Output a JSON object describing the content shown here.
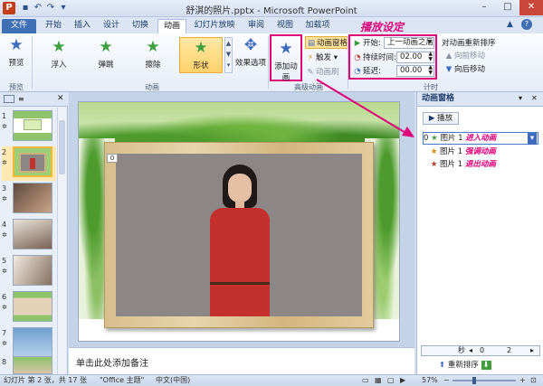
{
  "titlebar": {
    "title": "舒淇的照片.pptx - Microsoft PowerPoint",
    "app_icon": "P",
    "minimize": "–",
    "maximize": "□",
    "close": "✕",
    "help": "?",
    "ribbon_min": "▲"
  },
  "tabs": [
    {
      "label": "文件"
    },
    {
      "label": "开始"
    },
    {
      "label": "插入"
    },
    {
      "label": "设计"
    },
    {
      "label": "切换"
    },
    {
      "label": "动画"
    },
    {
      "label": "幻灯片放映"
    },
    {
      "label": "审阅"
    },
    {
      "label": "视图"
    },
    {
      "label": "加载项"
    }
  ],
  "ribbon": {
    "preview": {
      "label": "预览",
      "group": "预览"
    },
    "animations": [
      {
        "label": "浮入"
      },
      {
        "label": "弹跳"
      },
      {
        "label": "擦除"
      },
      {
        "label": "形状"
      }
    ],
    "animation_group": "动画",
    "effect_options": "效果选项",
    "add_animation": "添加动画",
    "anim_pane_btn": "动画窗格",
    "trigger": "触发",
    "anim_painter": "动画刷",
    "advanced_group": "高级动画",
    "start_label": "开始:",
    "start_value": "上一动画之后",
    "duration_label": "持续时间:",
    "duration_value": "02.00",
    "delay_label": "延迟:",
    "delay_value": "00.00",
    "reorder_title": "对动画重新排序",
    "move_earlier": "向前移动",
    "move_later": "向后移动",
    "timing_group": "计时",
    "annotation": "播放设定"
  },
  "slides": [
    {
      "num": "1"
    },
    {
      "num": "2"
    },
    {
      "num": "3"
    },
    {
      "num": "4"
    },
    {
      "num": "5"
    },
    {
      "num": "6"
    },
    {
      "num": "7"
    },
    {
      "num": "8"
    }
  ],
  "slide_badge": "0",
  "notes_placeholder": "单击此处添加备注",
  "anim_pane": {
    "title": "动画窗格",
    "play": "播放",
    "items": [
      {
        "index": "0",
        "name": "图片 1",
        "effect": "进入动画"
      },
      {
        "index": "",
        "name": "图片 1",
        "effect": "强调动画"
      },
      {
        "index": "",
        "name": "图片 1",
        "effect": "退出动画"
      }
    ],
    "seconds_label": "秒",
    "timeline_start": "0",
    "timeline_end": "2",
    "reorder": "重新排序"
  },
  "status": {
    "slide_info": "幻灯片 第 2 张，共 17 张",
    "theme": "\"Office 主题\"",
    "language": "中文(中国)",
    "zoom": "57%"
  },
  "colors": {
    "accent": "#e0007a",
    "file_tab": "#3f6fb5",
    "selected_gallery": "#ffd26a"
  }
}
